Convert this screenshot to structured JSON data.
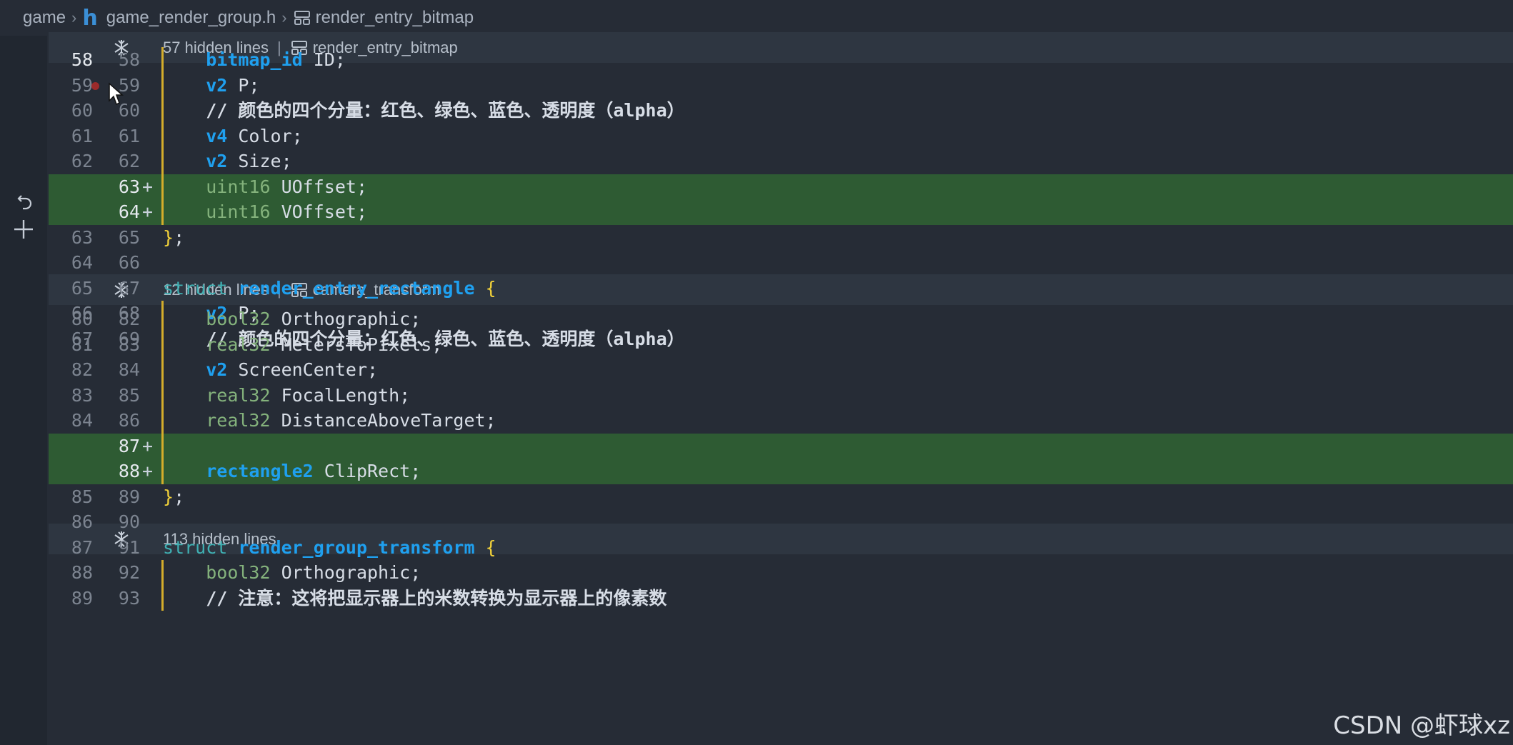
{
  "breadcrumb": {
    "folder": "game",
    "file_icon": "h",
    "file": "game_render_group.h",
    "symbol": "render_entry_bitmap"
  },
  "folds": [
    {
      "label": "57 hidden lines",
      "symbol": "render_entry_bitmap"
    },
    {
      "label": "12 hidden lines",
      "symbol": "camera_transform"
    },
    {
      "label": "113 hidden lines",
      "symbol": ""
    }
  ],
  "lines": [
    {
      "old": "58",
      "new": "58",
      "mark": "",
      "code": [
        [
          "indent",
          "    "
        ],
        [
          "tk-type",
          "bitmap_id"
        ],
        [
          "tk-txt",
          " ID;"
        ]
      ]
    },
    {
      "old": "59",
      "new": "59",
      "mark": "",
      "code": [
        [
          "indent",
          "    "
        ],
        [
          "tk-type",
          "v2"
        ],
        [
          "tk-txt",
          " P;"
        ]
      ]
    },
    {
      "old": "60",
      "new": "60",
      "mark": "",
      "code": [
        [
          "indent",
          "    "
        ],
        [
          "tk-cmt",
          "// 颜色的四个分量：红色、绿色、蓝色、透明度（alpha）"
        ]
      ]
    },
    {
      "old": "61",
      "new": "61",
      "mark": "",
      "code": [
        [
          "indent",
          "    "
        ],
        [
          "tk-type",
          "v4"
        ],
        [
          "tk-txt",
          " Color;"
        ]
      ]
    },
    {
      "old": "62",
      "new": "62",
      "mark": "",
      "code": [
        [
          "indent",
          "    "
        ],
        [
          "tk-type",
          "v2"
        ],
        [
          "tk-txt",
          " Size;"
        ]
      ]
    },
    {
      "old": "",
      "new": "63",
      "mark": "+",
      "code": [
        [
          "indent",
          "    "
        ],
        [
          "tk-plain-type",
          "uint16"
        ],
        [
          "tk-txt",
          " UOffset;"
        ]
      ]
    },
    {
      "old": "",
      "new": "64",
      "mark": "+",
      "code": [
        [
          "indent",
          "    "
        ],
        [
          "tk-plain-type",
          "uint16"
        ],
        [
          "tk-txt",
          " VOffset;"
        ]
      ]
    },
    {
      "old": "63",
      "new": "65",
      "mark": "",
      "code": [
        [
          "tk-brace",
          "}"
        ],
        [
          "tk-txt",
          ";"
        ]
      ]
    },
    {
      "old": "64",
      "new": "66",
      "mark": "",
      "code": []
    },
    {
      "old": "65",
      "new": "67",
      "mark": "",
      "code": [
        [
          "tk-kw",
          "struct"
        ],
        [
          "tk-txt",
          " "
        ],
        [
          "tk-name",
          "render_entry_rectangle"
        ],
        [
          "tk-txt",
          " "
        ],
        [
          "tk-brace",
          "{"
        ]
      ]
    },
    {
      "old": "66",
      "new": "68",
      "mark": "",
      "code": [
        [
          "indent",
          "    "
        ],
        [
          "tk-type",
          "v2"
        ],
        [
          "tk-txt",
          " P;"
        ]
      ]
    },
    {
      "old": "67",
      "new": "69",
      "mark": "",
      "code": [
        [
          "indent",
          "    "
        ],
        [
          "tk-cmt",
          "// 颜色的四个分量：红色、绿色、蓝色、透明度（alpha）"
        ]
      ]
    },
    {
      "old": "80",
      "new": "82",
      "mark": "",
      "code": [
        [
          "indent",
          "    "
        ],
        [
          "tk-plain-type",
          "bool32"
        ],
        [
          "tk-txt",
          " Orthographic;"
        ]
      ]
    },
    {
      "old": "81",
      "new": "83",
      "mark": "",
      "code": [
        [
          "indent",
          "    "
        ],
        [
          "tk-plain-type",
          "real32"
        ],
        [
          "tk-txt",
          " MetersToPixels;"
        ]
      ]
    },
    {
      "old": "82",
      "new": "84",
      "mark": "",
      "code": [
        [
          "indent",
          "    "
        ],
        [
          "tk-type",
          "v2"
        ],
        [
          "tk-txt",
          " ScreenCenter;"
        ]
      ]
    },
    {
      "old": "83",
      "new": "85",
      "mark": "",
      "code": [
        [
          "indent",
          "    "
        ],
        [
          "tk-plain-type",
          "real32"
        ],
        [
          "tk-txt",
          " FocalLength;"
        ]
      ]
    },
    {
      "old": "84",
      "new": "86",
      "mark": "",
      "code": [
        [
          "indent",
          "    "
        ],
        [
          "tk-plain-type",
          "real32"
        ],
        [
          "tk-txt",
          " DistanceAboveTarget;"
        ]
      ]
    },
    {
      "old": "",
      "new": "87",
      "mark": "+",
      "code": []
    },
    {
      "old": "",
      "new": "88",
      "mark": "+",
      "code": [
        [
          "indent",
          "    "
        ],
        [
          "tk-type",
          "rectangle2"
        ],
        [
          "tk-txt",
          " ClipRect;"
        ]
      ]
    },
    {
      "old": "85",
      "new": "89",
      "mark": "",
      "code": [
        [
          "tk-brace",
          "}"
        ],
        [
          "tk-txt",
          ";"
        ]
      ]
    },
    {
      "old": "86",
      "new": "90",
      "mark": "",
      "code": []
    },
    {
      "old": "87",
      "new": "91",
      "mark": "",
      "code": [
        [
          "tk-kw",
          "struct"
        ],
        [
          "tk-txt",
          " "
        ],
        [
          "tk-name",
          "render_group_transform"
        ],
        [
          "tk-txt",
          " "
        ],
        [
          "tk-brace",
          "{"
        ]
      ]
    },
    {
      "old": "88",
      "new": "92",
      "mark": "",
      "code": [
        [
          "indent",
          "    "
        ],
        [
          "tk-plain-type",
          "bool32"
        ],
        [
          "tk-txt",
          " Orthographic;"
        ]
      ]
    },
    {
      "old": "89",
      "new": "93",
      "mark": "",
      "code": [
        [
          "indent",
          "    "
        ],
        [
          "tk-cmt",
          "// 注意：这将把显示器上的米数转换为显示器上的像素数"
        ]
      ]
    }
  ],
  "watermark": "CSDN @虾球xz",
  "colors": {
    "background": "#262c36",
    "added_line": "#2e5b33",
    "fold_bar": "#2e3641",
    "type_blue": "#1fa0ef",
    "plain_type_green": "#84b27c",
    "keyword_teal": "#3fb0b3",
    "brace_yellow": "#f2d23a",
    "modified_bar": "#d4ad2b",
    "breakpoint_red": "#9c2b2b"
  },
  "icons": {
    "fold": "unfold-icon",
    "symbol": "symbol-structure-icon",
    "revert": "revert-icon",
    "stage": "stage-plus-icon",
    "breakpoint": "breakpoint-dot-icon",
    "cursor": "mouse-pointer-icon"
  }
}
